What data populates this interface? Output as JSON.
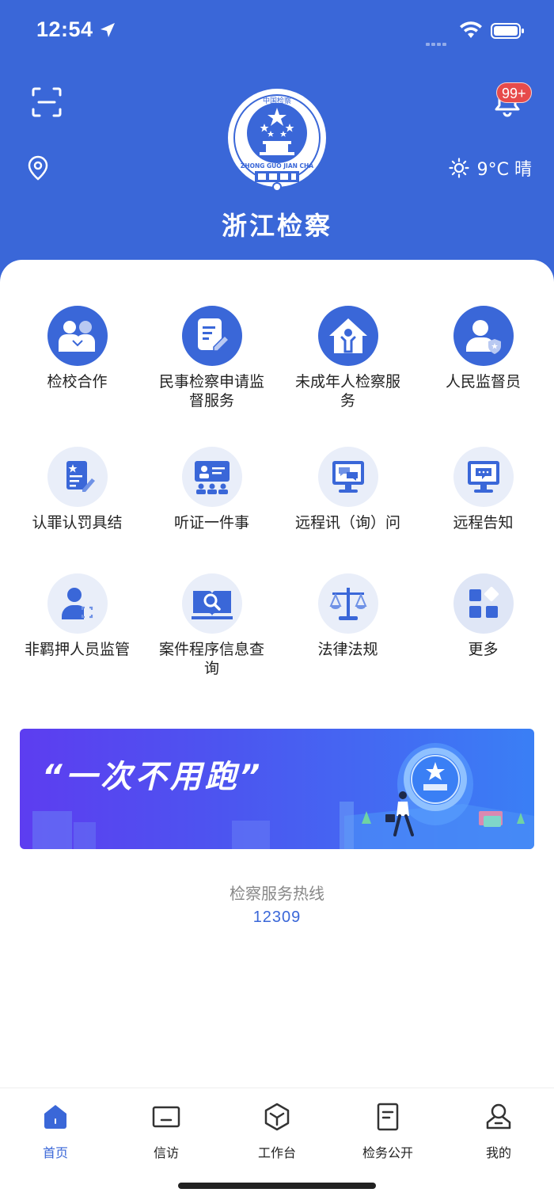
{
  "status_bar": {
    "time": "12:54"
  },
  "header": {
    "notification_badge": "99+",
    "weather": "9°C 晴",
    "brand": "浙江检察",
    "emblem_text": "ZHONG GUO JIAN CHA · 中国检察"
  },
  "services": [
    {
      "label": "检校合作",
      "icon": "two-people-icon",
      "style": "solid"
    },
    {
      "label": "民事检察申请监督服务",
      "icon": "document-edit-icon",
      "style": "solid"
    },
    {
      "label": "未成年人检察服务",
      "icon": "house-child-icon",
      "style": "solid"
    },
    {
      "label": "人民监督员",
      "icon": "supervisor-badge-icon",
      "style": "solid"
    },
    {
      "label": "认罪认罚具结",
      "icon": "signed-document-icon",
      "style": "soft"
    },
    {
      "label": "听证一件事",
      "icon": "hearing-panel-icon",
      "style": "soft"
    },
    {
      "label": "远程讯（询）问",
      "icon": "remote-interview-icon",
      "style": "soft"
    },
    {
      "label": "远程告知",
      "icon": "remote-notice-icon",
      "style": "soft"
    },
    {
      "label": "非羁押人员监管",
      "icon": "person-monitor-icon",
      "style": "soft"
    },
    {
      "label": "案件程序信息查询",
      "icon": "book-search-icon",
      "style": "soft"
    },
    {
      "label": "法律法规",
      "icon": "scales-icon",
      "style": "soft"
    },
    {
      "label": "更多",
      "icon": "more-grid-icon",
      "style": "soft"
    }
  ],
  "banner": {
    "title": "“一次不用跑”"
  },
  "hotline": {
    "title": "检察服务热线",
    "number": "12309"
  },
  "tabbar": [
    {
      "label": "首页",
      "icon": "home-icon",
      "active": true
    },
    {
      "label": "信访",
      "icon": "petition-icon",
      "active": false
    },
    {
      "label": "工作台",
      "icon": "workbench-cube-icon",
      "active": false
    },
    {
      "label": "检务公开",
      "icon": "public-document-icon",
      "active": false
    },
    {
      "label": "我的",
      "icon": "profile-icon",
      "active": false
    }
  ],
  "colors": {
    "primary": "#3a67d8",
    "badge": "#e74b4b",
    "soft_icon_bg": "#e9eef9"
  }
}
